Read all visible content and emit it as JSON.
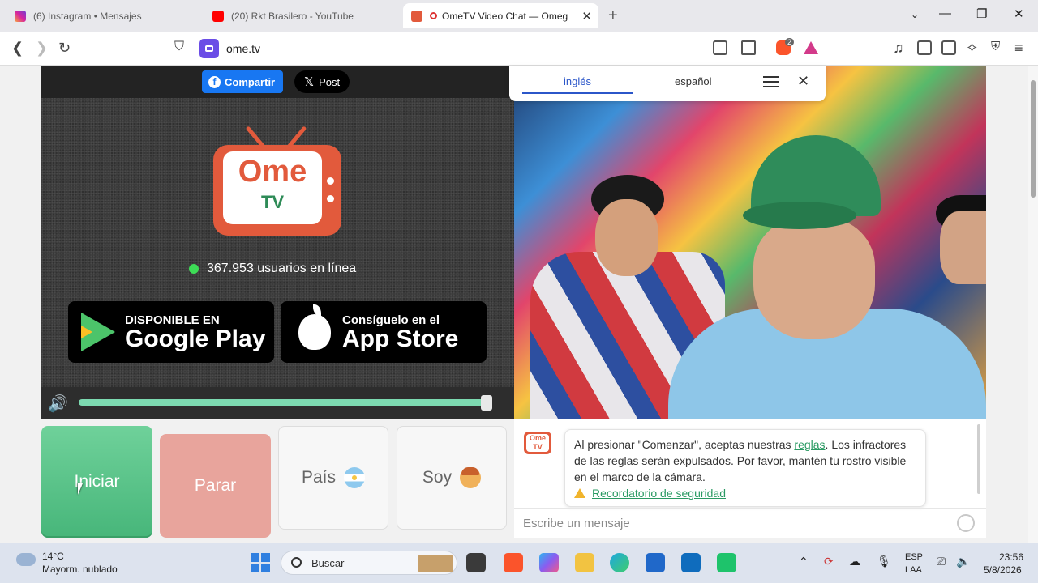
{
  "tabs": [
    {
      "title": "(6) Instagram • Mensajes",
      "favicon": "instagram-icon",
      "color": "#d6249f"
    },
    {
      "title": "(20) Rkt Brasilero - YouTube",
      "favicon": "youtube-icon",
      "color": "#ff0000"
    },
    {
      "title": "OmeTV Video Chat — Omeg",
      "favicon": "ometv-icon",
      "color": "#e25a3c",
      "active": true
    }
  ],
  "toolbar": {
    "url": "ome.tv",
    "brave_badge": "2"
  },
  "share": {
    "facebook_label": "Compartir",
    "x_label": "Post",
    "facebook_color": "#1877f2"
  },
  "logo": {
    "line1": "Ome",
    "line2": "TV",
    "color": "#e25a3c"
  },
  "online": {
    "text": "367.953 usuarios en línea"
  },
  "stores": {
    "google": {
      "small": "DISPONIBLE EN",
      "big": "Google Play"
    },
    "apple": {
      "small": "Consíguelo en el",
      "big": "App Store"
    }
  },
  "volume": {
    "level": 0.97
  },
  "languages": {
    "tab1": "inglés",
    "tab2": "español",
    "active": "inglés"
  },
  "buttons": {
    "start": "Iniciar",
    "stop": "Parar",
    "country": "País",
    "gender": "Soy",
    "start_color": "#4cb97f",
    "stop_color": "#e8a49c"
  },
  "chat": {
    "logo_line1": "Ome",
    "logo_line2": "TV",
    "msg_part1": "Al presionar \"Comenzar\", aceptas nuestras ",
    "msg_link": "reglas",
    "msg_part2": ". Los infractores de las reglas serán expulsados. Por favor, mantén tu rostro visible en el marco de la cámara.",
    "safety_link": "Recordatorio de seguridad",
    "input_placeholder": "Escribe un mensaje"
  },
  "taskbar": {
    "weather_temp": "14°C",
    "weather_desc": "Mayorm. nublado",
    "search_label": "Buscar",
    "lang_line1": "ESP",
    "lang_line2": "LAA",
    "time": "23:56",
    "date": "5/8/2026"
  }
}
